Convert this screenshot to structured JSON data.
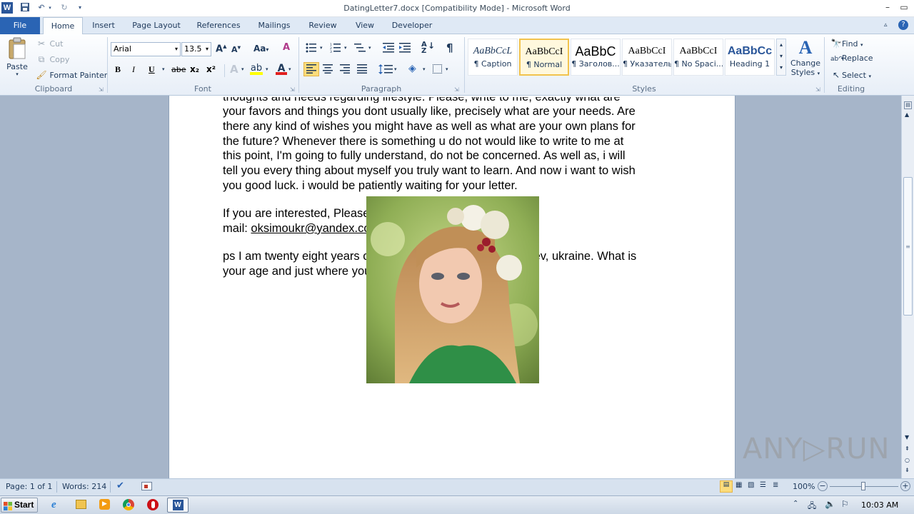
{
  "window": {
    "title": "DatingLetter7.docx [Compatibility Mode]  -  Microsoft Word",
    "app_icon": "W",
    "controls": [
      "minimize",
      "maximize",
      "close"
    ]
  },
  "tabs": [
    {
      "label": "File"
    },
    {
      "label": "Home"
    },
    {
      "label": "Insert"
    },
    {
      "label": "Page Layout"
    },
    {
      "label": "References"
    },
    {
      "label": "Mailings"
    },
    {
      "label": "Review"
    },
    {
      "label": "View"
    },
    {
      "label": "Developer"
    }
  ],
  "ribbon": {
    "clipboard": {
      "group_label": "Clipboard",
      "paste": "Paste",
      "cut": "Cut",
      "copy": "Copy",
      "format_painter": "Format Painter"
    },
    "font": {
      "group_label": "Font",
      "font_name": "Arial",
      "font_size": "13.5",
      "bold": "B",
      "italic": "I",
      "underline": "U",
      "strike": "abe",
      "subscript": "x₂",
      "superscript": "x²",
      "grow": "A",
      "shrink": "A",
      "change_case": "Aa",
      "font_color_glyph": "A",
      "accent_red": "#e02020",
      "highlight_yellow": "#ffff00"
    },
    "paragraph": {
      "group_label": "Paragraph",
      "pilcrow": "¶"
    },
    "styles": {
      "group_label": "Styles",
      "tiles": [
        {
          "sample": "AaBbCcL",
          "name": "¶ Caption"
        },
        {
          "sample": "AaBbCcI",
          "name": "¶ Normal"
        },
        {
          "sample": "AaBbC",
          "name": "¶ Заголов..."
        },
        {
          "sample": "AaBbCcI",
          "name": "¶ Указатель"
        },
        {
          "sample": "AaBbCcI",
          "name": "¶ No Spaci..."
        },
        {
          "sample": "AaBbCс",
          "name": "Heading 1"
        }
      ],
      "change_styles": "Change Styles",
      "change_styles_line1": "Change",
      "change_styles_line2": "Styles"
    },
    "editing": {
      "group_label": "Editing",
      "find": "Find",
      "replace": "Replace",
      "select": "Select"
    }
  },
  "document": {
    "partial_line": "thoughts and needs regarding lifestyle. Please, write to me, exactly what are",
    "para1": [
      "your favors and things you dont usually like, precisely what are your needs. Are",
      "there any kind of wishes you might have as well as what are your own plans for",
      "the future? Whenever there is something u do not would like to write to me at",
      "this point, I'm  going to fully understand, do not be concerned. As well as, i will",
      "tell you every thing about myself you truly want to learn. And now i want to wish",
      "you good luck. i would be patiently waiting for your letter."
    ],
    "para2_line1": "If you are interested, Please answer ONLY to my personal e-",
    "para2_prefix": "mail: ",
    "email": "oksimoukr@yandex.com",
    "para3": [
      "ps I am twenty eight years old and also i am coming from Kiev, ukraine. What is",
      "your age and just where you from?"
    ]
  },
  "statusbar": {
    "page": "Page: 1 of 1",
    "words": "Words: 214",
    "zoom": "100%"
  },
  "taskbar": {
    "start": "Start",
    "clock": "10:03 AM"
  },
  "watermark": "ANY▷RUN"
}
